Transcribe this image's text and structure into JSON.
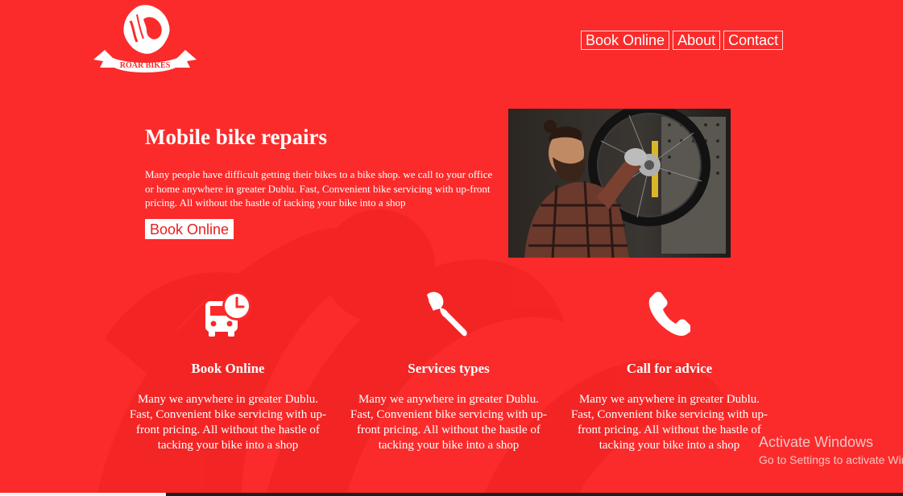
{
  "brand": {
    "name": "ROAR BIKES"
  },
  "nav": [
    {
      "label": "Book Online"
    },
    {
      "label": "About"
    },
    {
      "label": "Contact"
    }
  ],
  "hero": {
    "title": "Mobile bike repairs",
    "text": "Many people have difficult getting their bikes to a bike shop. we call to your office or home anywhere in greater Dublu. Fast, Convenient bike servicing with up-front pricing. All without the hastle of tacking your bike into a shop",
    "button_label": "Book Online"
  },
  "features": [
    {
      "icon": "bus-clock-icon",
      "title": "Book Online",
      "text": "Many we anywhere in greater Dublu. Fast, Convenient bike servicing with up-front pricing. All without the hastle of tacking your bike into a shop"
    },
    {
      "icon": "wrench-icon",
      "title": "Services types",
      "text": "Many we anywhere in greater Dublu. Fast, Convenient bike servicing with up-front pricing. All without the hastle of tacking your bike into a shop"
    },
    {
      "icon": "phone-icon",
      "title": "Call for advice",
      "text": "Many we anywhere in greater Dublu. Fast, Convenient bike servicing with up-front pricing. All without the hastle of tacking your bike into a shop"
    }
  ],
  "watermark": {
    "title": "Activate Windows",
    "subtitle": "Go to Settings to activate Windows."
  },
  "colors": {
    "background": "#fb2b2b",
    "text": "#ffffff",
    "button_text": "#e71f1f"
  }
}
